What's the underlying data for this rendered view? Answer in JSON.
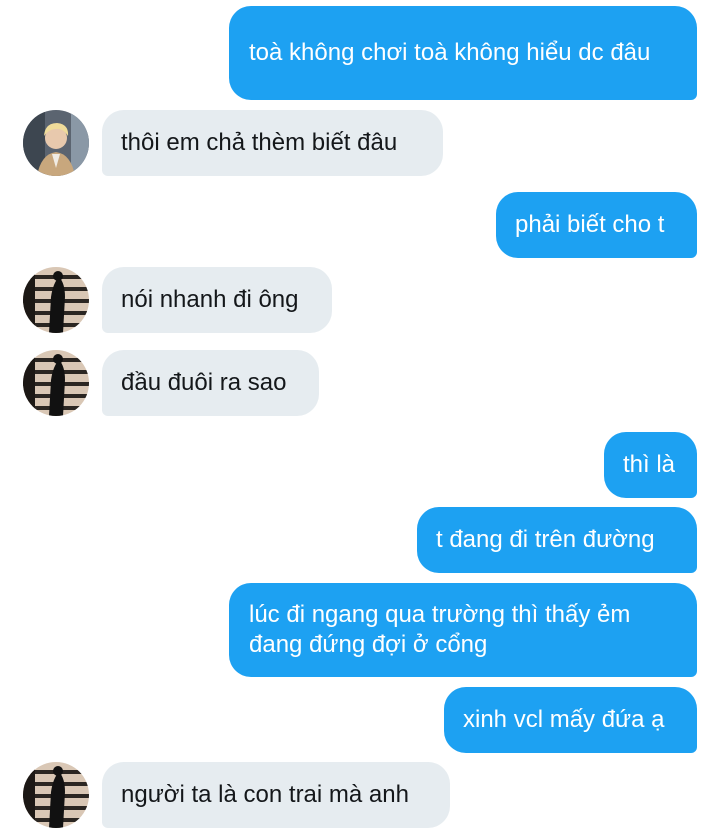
{
  "messages": [
    {
      "id": "m1",
      "dir": "out",
      "text": "toà không chơi toà không hiểu dc đâu"
    },
    {
      "id": "m2",
      "dir": "in",
      "text": "thôi em chả thèm biết đâu",
      "avatar": "blond-person-avatar"
    },
    {
      "id": "m3",
      "dir": "out",
      "text": "phải biết cho t"
    },
    {
      "id": "m4",
      "dir": "in",
      "text": "nói nhanh đi ông",
      "avatar": "silhouette-window-avatar"
    },
    {
      "id": "m5",
      "dir": "in",
      "text": "đầu đuôi ra sao",
      "avatar": "silhouette-window-avatar"
    },
    {
      "id": "m6",
      "dir": "out",
      "text": "thì là"
    },
    {
      "id": "m7",
      "dir": "out",
      "text": "t đang đi trên đường"
    },
    {
      "id": "m8",
      "dir": "out",
      "text": "lúc đi ngang qua trường thì thấy ẻm đang đứng đợi ở cổng"
    },
    {
      "id": "m9",
      "dir": "out",
      "text": "xinh vcl mấy đứa ạ"
    },
    {
      "id": "m10",
      "dir": "in",
      "text": "người ta là con trai mà anh",
      "avatar": "silhouette-window-avatar"
    }
  ],
  "colors": {
    "outgoing_bubble": "#1da1f2",
    "incoming_bubble": "#e6ecf0",
    "outgoing_text": "#ffffff",
    "incoming_text": "#14171a"
  }
}
